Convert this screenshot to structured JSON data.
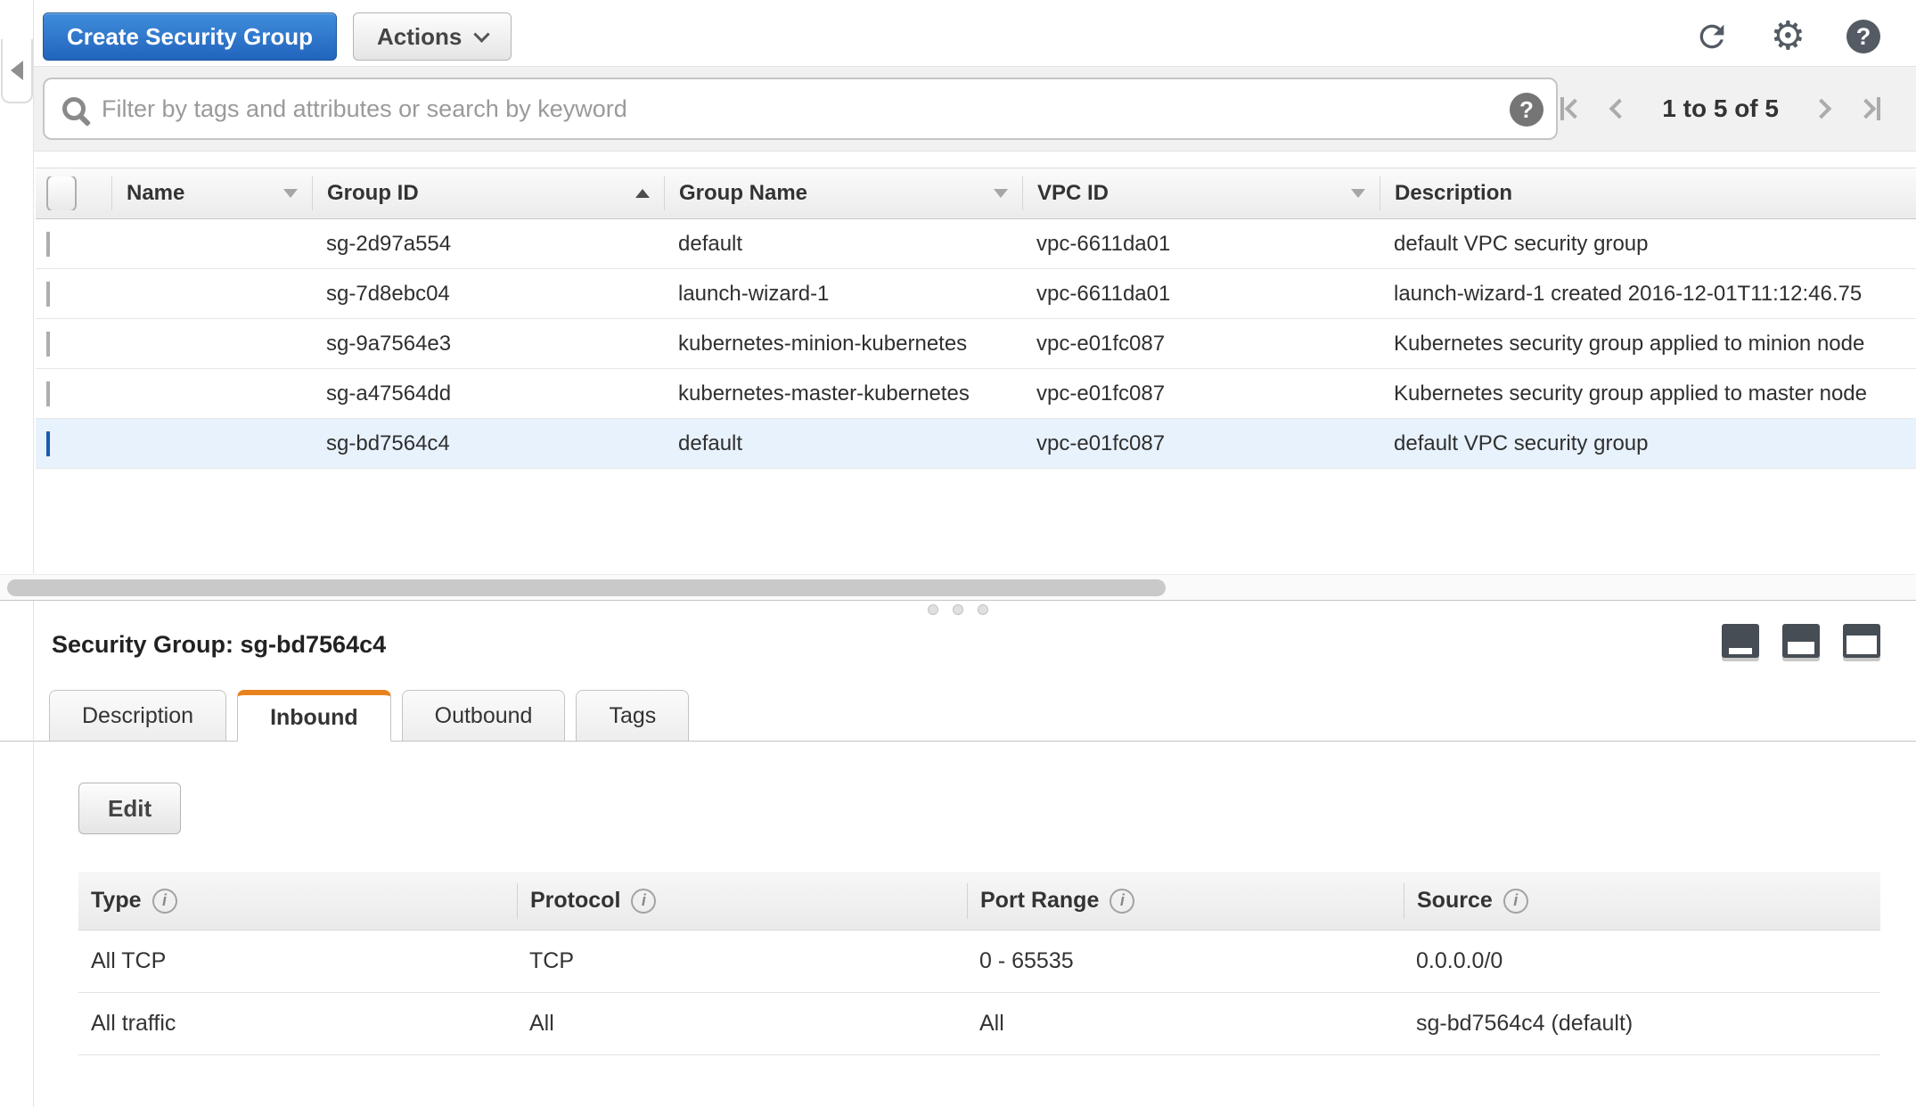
{
  "toolbar": {
    "create_label": "Create Security Group",
    "actions_label": "Actions"
  },
  "filter": {
    "placeholder": "Filter by tags and attributes or search by keyword"
  },
  "pagination": {
    "range_text": "1 to 5 of 5"
  },
  "icons": {
    "gear": "⚙",
    "help": "?",
    "info": "i"
  },
  "table": {
    "columns": {
      "name": "Name",
      "group_id": "Group ID",
      "group_name": "Group Name",
      "vpc_id": "VPC ID",
      "description": "Description"
    },
    "sort": {
      "column": "Group ID",
      "direction": "ascending"
    },
    "rows": [
      {
        "name": "",
        "group_id": "sg-2d97a554",
        "group_name": "default",
        "vpc_id": "vpc-6611da01",
        "description": "default VPC security group",
        "selected": false
      },
      {
        "name": "",
        "group_id": "sg-7d8ebc04",
        "group_name": "launch-wizard-1",
        "vpc_id": "vpc-6611da01",
        "description": "launch-wizard-1 created 2016-12-01T11:12:46.75",
        "selected": false
      },
      {
        "name": "",
        "group_id": "sg-9a7564e3",
        "group_name": "kubernetes-minion-kubernetes",
        "vpc_id": "vpc-e01fc087",
        "description": "Kubernetes security group applied to minion node",
        "selected": false
      },
      {
        "name": "",
        "group_id": "sg-a47564dd",
        "group_name": "kubernetes-master-kubernetes",
        "vpc_id": "vpc-e01fc087",
        "description": "Kubernetes security group applied to master node",
        "selected": false
      },
      {
        "name": "",
        "group_id": "sg-bd7564c4",
        "group_name": "default",
        "vpc_id": "vpc-e01fc087",
        "description": "default VPC security group",
        "selected": true
      }
    ]
  },
  "details": {
    "title": "Security Group: sg-bd7564c4",
    "tabs": {
      "description": "Description",
      "inbound": "Inbound",
      "outbound": "Outbound",
      "tags": "Tags"
    },
    "active_tab": "Inbound",
    "edit_label": "Edit",
    "inbound": {
      "columns": {
        "type": "Type",
        "protocol": "Protocol",
        "port_range": "Port Range",
        "source": "Source"
      },
      "rows": [
        {
          "type": "All TCP",
          "protocol": "TCP",
          "port_range": "0 - 65535",
          "source": "0.0.0.0/0"
        },
        {
          "type": "All traffic",
          "protocol": "All",
          "port_range": "All",
          "source": "sg-bd7564c4 (default)"
        }
      ]
    }
  },
  "colors": {
    "accent_blue": "#2e77d0",
    "selected_row_bg": "#e7f2fc",
    "active_tab_orange": "#e8821c"
  }
}
